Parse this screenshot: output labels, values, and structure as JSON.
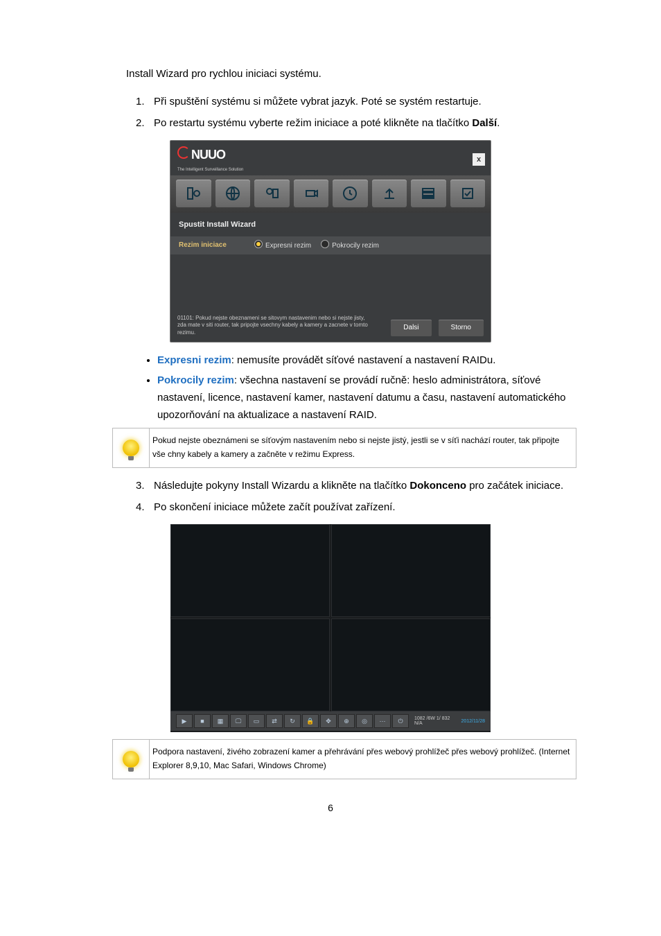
{
  "intro": "Install Wizard pro rychlou iniciaci systému.",
  "steps": {
    "s1": {
      "n": "1.",
      "t": "Při spuštění systému si můžete vybrat jazyk. Poté se systém restartuje."
    },
    "s2": {
      "n": "2.",
      "t1": "Po restartu systému vyberte režim iniciace a poté klikněte na tlačítko ",
      "bold": "Další",
      "t2": "."
    },
    "s3": {
      "n": "3.",
      "t1": "Následujte pokyny Install Wizardu a klikněte na tlačítko ",
      "bold": "Dokonceno",
      "t2": " pro začátek iniciace."
    },
    "s4": {
      "n": "4.",
      "t": "Po skončení iniciace můžete začít používat zařízení."
    }
  },
  "modes": {
    "express": {
      "name": "Expresni rezim",
      "desc": ": nemusíte provádět síťové nastavení a nastavení RAIDu."
    },
    "advanced": {
      "name": "Pokrocily rezim",
      "desc": ": všechna nastavení se provádí ručně: heslo administrátora, síťové nastavení, licence, nastavení kamer, nastavení datumu a času, nastavení automatického upozorňování na aktualizace a nastavení RAID."
    }
  },
  "tip1": "Pokud nejste obeznámeni se síťovým nastavením nebo si nejste jistý, jestli se v síťi nachází router, tak připojte vše chny kabely a kamery a začněte v režimu Express.",
  "tip2": "Podpora nastavení, živého zobrazení kamer a přehrávání přes webový prohlížeč přes webový prohlížeč. (Internet Explorer 8,9,10, Mac Safari, Windows Chrome)",
  "wizard": {
    "brand": "NUUO",
    "tagline": "The Intelligent Surveillance Solution",
    "subtitle": "Spustit Install Wizard",
    "mode_label": "Rezim iniciace",
    "opt_express": "Expresni rezim",
    "opt_advanced": "Pokrocily rezim",
    "help": "01101: Pokud nejste obeznameni se sitovym nastavenim nebo si nejste jisty, zda mate v siti router, tak pripojte vsechny kabely a kamery a zacnete v tomto rezimu.",
    "btn_next": "Dalsi",
    "btn_cancel": "Storno",
    "close": "x"
  },
  "live": {
    "info_top": "1082 /6W 1/ 832",
    "info_bottom": "N/A",
    "date": "2012/11/28"
  },
  "pagenum": "6"
}
